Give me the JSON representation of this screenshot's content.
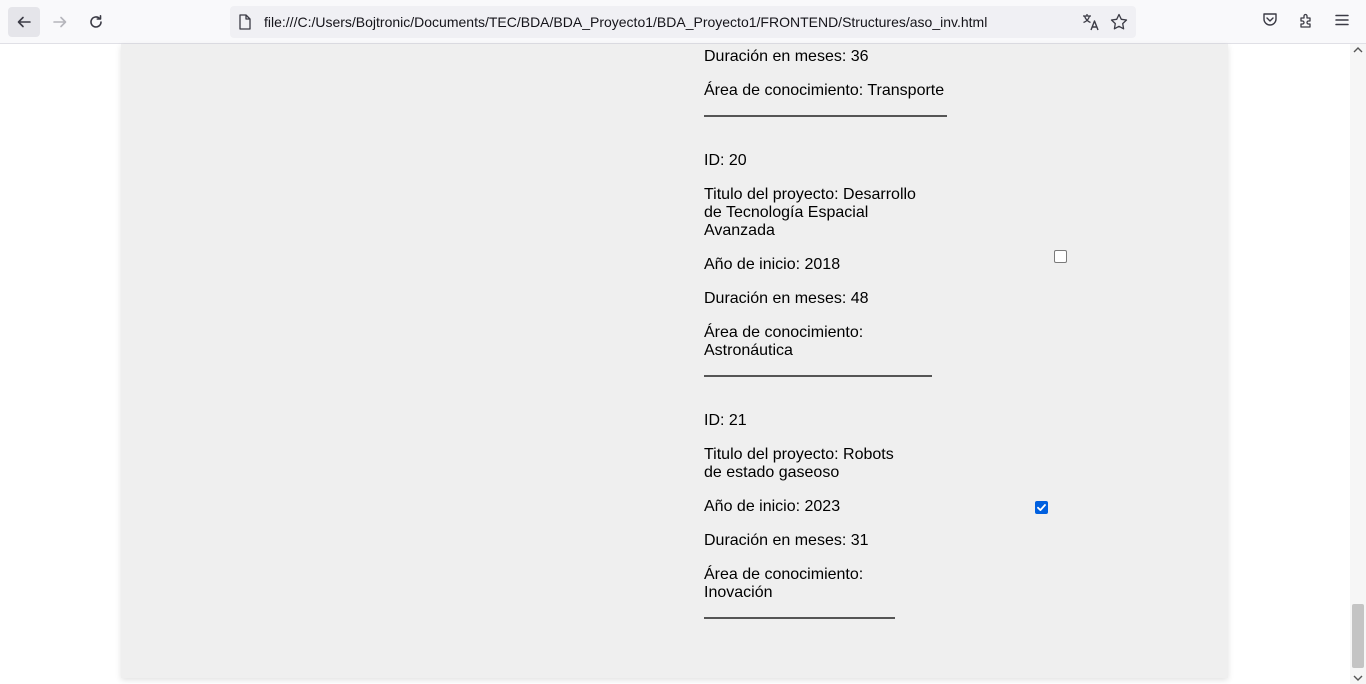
{
  "browser": {
    "url": "file:///C:/Users/Bojtronic/Documents/TEC/BDA/BDA_Proyecto1/BDA_Proyecto1/FRONTEND/Structures/aso_inv.html",
    "icons": [
      "back-arrow-icon",
      "forward-arrow-icon",
      "reload-icon",
      "page-icon",
      "translate-icon",
      "bookmark-star-icon",
      "pocket-icon",
      "extensions-icon",
      "menu-icon"
    ]
  },
  "records": {
    "r19": {
      "duration": "Duración en meses: 36",
      "area": "Área de conocimiento: Transporte"
    },
    "r20": {
      "id": "ID: 20",
      "title_line1": "Titulo del proyecto: Desarrollo",
      "title_line2": "de Tecnología Espacial",
      "title_line3": "Avanzada",
      "year": "Año de inicio: 2018",
      "duration": "Duración en meses: 48",
      "area_line1": "Área de conocimiento:",
      "area_line2": "Astronáutica",
      "selected": false
    },
    "r21": {
      "id": "ID: 21",
      "title_line1": "Titulo del proyecto: Robots",
      "title_line2": "de estado gaseoso",
      "year": "Año de inicio: 2023",
      "duration": "Duración en meses: 31",
      "area_line1": "Área de conocimiento:",
      "area_line2": "Inovación",
      "selected": true
    }
  },
  "colors": {
    "accent": "#0060df",
    "panel": "#efefef"
  }
}
